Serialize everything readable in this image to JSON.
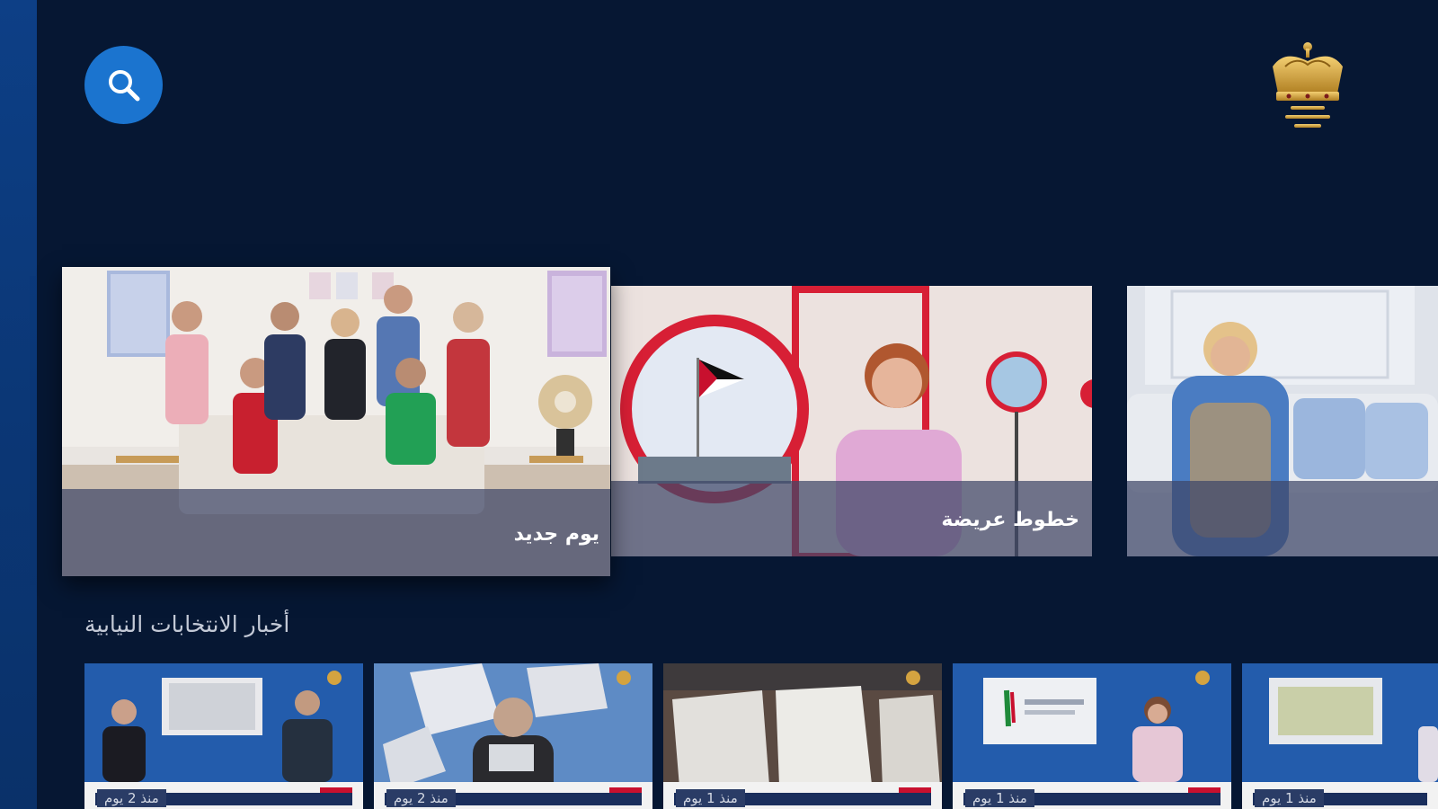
{
  "app": {
    "search_label": "Search"
  },
  "hero": {
    "cards": [
      {
        "title": "يوم جديد"
      },
      {
        "title": "خطوط عريضة"
      },
      {
        "title": ""
      }
    ]
  },
  "section": {
    "title": "أخبار الانتخابات النيابية",
    "items": [
      {
        "time": "منذ 2 يوم"
      },
      {
        "time": "منذ 2 يوم"
      },
      {
        "time": "منذ 1 يوم"
      },
      {
        "time": "منذ 1 يوم"
      },
      {
        "time": "منذ 1 يوم"
      }
    ]
  },
  "colors": {
    "background": "#061733",
    "side_rail": "#0c3a7c",
    "search_button": "#1b74cf",
    "logo_gold": "#d4a340",
    "card_overlay": "#3e4668"
  },
  "icons": {
    "search": "magnifier-icon",
    "logo": "crown-logo"
  }
}
